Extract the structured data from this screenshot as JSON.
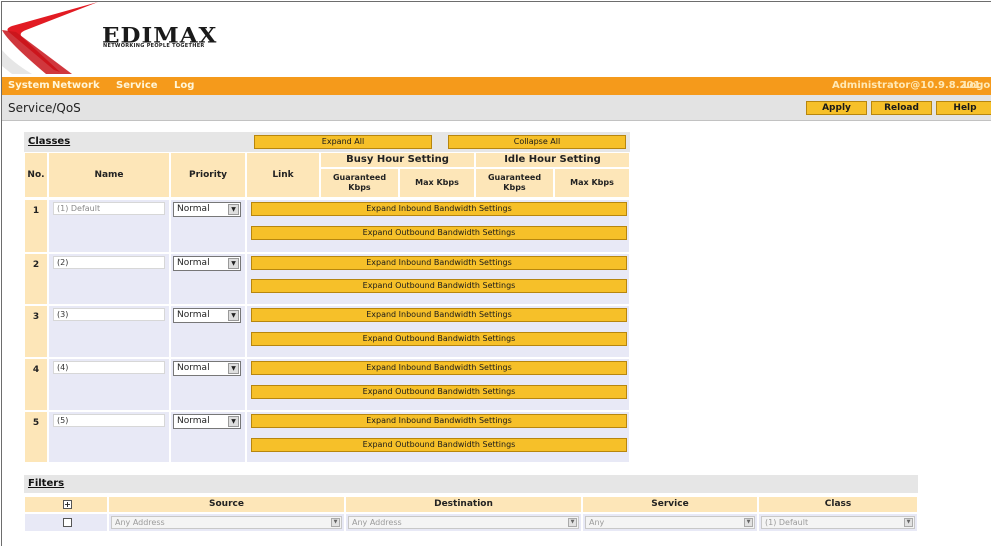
{
  "brand": {
    "name": "EDIMAX",
    "tagline": "NETWORKING PEOPLE TOGETHER"
  },
  "menu": {
    "items": [
      "System",
      "Network",
      "Service",
      "Log"
    ],
    "admin_info": "Administrator@10.9.8.201",
    "logout": "Logou"
  },
  "page": {
    "title": "Service/QoS",
    "apply_label": "Apply",
    "reload_label": "Reload",
    "help_label": "Help"
  },
  "classes": {
    "label": "Classes",
    "expand_all": "Expand All",
    "collapse_all": "Collapse All",
    "headers": {
      "no": "No.",
      "name": "Name",
      "priority": "Priority",
      "link": "Link",
      "busy": "Busy Hour Setting",
      "idle": "Idle Hour Setting",
      "guaranteed": "Guaranteed Kbps",
      "max": "Max Kbps"
    },
    "inbound_label": "Expand Inbound Bandwidth Settings",
    "outbound_label": "Expand Outbound Bandwidth Settings",
    "rows": [
      {
        "no": "1",
        "name": "(1) Default",
        "priority": "Normal"
      },
      {
        "no": "2",
        "name": "(2)",
        "priority": "Normal"
      },
      {
        "no": "3",
        "name": "(3)",
        "priority": "Normal"
      },
      {
        "no": "4",
        "name": "(4)",
        "priority": "Normal"
      },
      {
        "no": "5",
        "name": "(5)",
        "priority": "Normal"
      }
    ]
  },
  "filters": {
    "label": "Filters",
    "headers": {
      "source": "Source",
      "destination": "Destination",
      "service": "Service",
      "class": "Class"
    },
    "row": {
      "source": "Any Address",
      "destination": "Any Address",
      "service": "Any",
      "class": "(1) Default"
    }
  },
  "colors": {
    "orange": "#f59a1b",
    "gold": "#f6c029",
    "header_bg": "#fde6b8",
    "row_bg": "#e8e9f6",
    "logo_red": "#e21b23"
  }
}
